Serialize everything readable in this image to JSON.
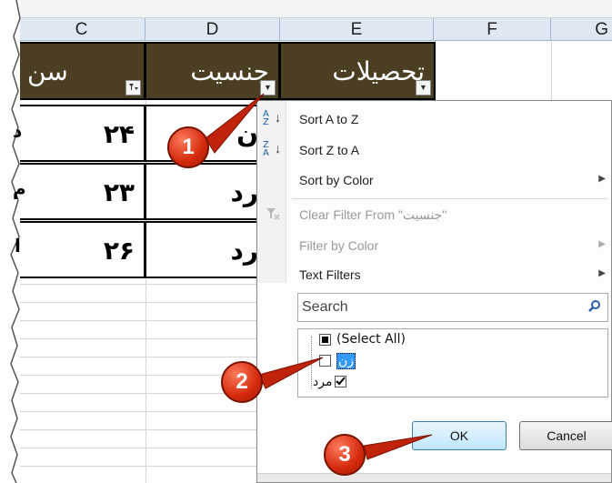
{
  "columns": [
    "C",
    "D",
    "E",
    "F",
    "G"
  ],
  "headers": {
    "c": "سن",
    "d": "جنسیت",
    "e": "تحصیلات"
  },
  "rows": [
    {
      "age": "۲۴",
      "gender": "ن"
    },
    {
      "age": "۲۳",
      "gender": "رد"
    },
    {
      "age": "۲۶",
      "gender": "رد"
    }
  ],
  "left_edge_fragments": [
    "د",
    "م",
    "ا"
  ],
  "menu": {
    "sort_az": "Sort A to Z",
    "sort_za": "Sort Z to A",
    "sort_color": "Sort by Color",
    "clear_filter": "Clear Filter From \"جنسیت\"",
    "filter_color": "Filter by Color",
    "text_filters": "Text Filters",
    "search_placeholder": "Search",
    "list": {
      "select_all": "(Select All)",
      "item1": "زن",
      "item2": "مرد"
    },
    "ok": "OK",
    "cancel": "Cancel"
  },
  "sort_icon_az": "A↓Z",
  "sort_icon_za": "Z↓A",
  "callouts": [
    "1",
    "2",
    "3"
  ],
  "colors": {
    "header_bg": "#4a3f22",
    "callout": "#d3290c"
  }
}
